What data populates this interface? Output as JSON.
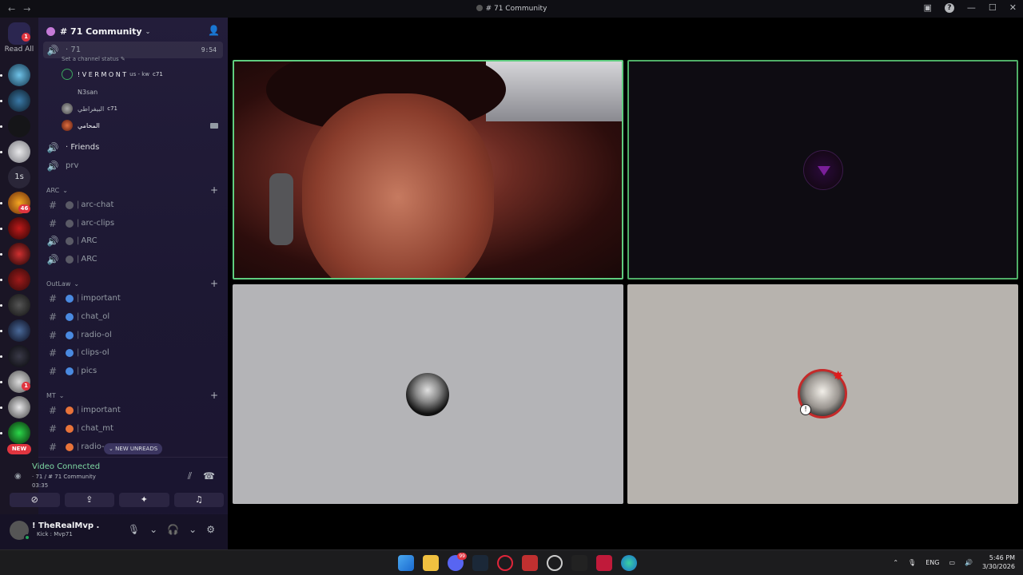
{
  "window": {
    "title": "# 71 Community",
    "nav_back": "←",
    "nav_forward": "→"
  },
  "guilds": {
    "read_all_label": "Read All",
    "home_badge": "1",
    "text_server": "1s",
    "badge_46": "46",
    "badge_1": "1",
    "new_label": "NEW"
  },
  "server": {
    "name": "# 71 Community",
    "chevron": "⌄"
  },
  "active_voice": {
    "name": "· 71",
    "time": "9:54",
    "status_hint": "Set a channel status ✎",
    "users": [
      {
        "name": "! V E R M O N T",
        "suffix": "us - kw",
        "tag": "c71"
      },
      {
        "name": "N3san",
        "suffix": "",
        "tag": ""
      },
      {
        "name": "البيفراطي",
        "suffix": "",
        "tag": "c71"
      },
      {
        "name": "المحامي",
        "suffix": "",
        "tag": ""
      }
    ]
  },
  "channels_top": [
    {
      "name": "· Friends"
    },
    {
      "name": "prv"
    }
  ],
  "categories": [
    {
      "name": "ARC",
      "channels": [
        {
          "name": "arc-chat",
          "type": "text"
        },
        {
          "name": "arc-clips",
          "type": "text"
        },
        {
          "name": "ARC",
          "type": "voice"
        },
        {
          "name": "ARC",
          "type": "voice"
        }
      ]
    },
    {
      "name": "OutLaw",
      "channels": [
        {
          "name": "important",
          "type": "text"
        },
        {
          "name": "chat_ol",
          "type": "text"
        },
        {
          "name": "radio-ol",
          "type": "text"
        },
        {
          "name": "clips-ol",
          "type": "text"
        },
        {
          "name": "pics",
          "type": "text"
        }
      ]
    },
    {
      "name": "MT",
      "channels": [
        {
          "name": "important",
          "type": "text"
        },
        {
          "name": "chat_mt",
          "type": "text"
        },
        {
          "name": "radio-",
          "type": "text"
        }
      ]
    }
  ],
  "new_unreads": "⌄ NEW UNREADS",
  "voice_panel": {
    "status": "Video Connected",
    "location": "· 71 / # 71 Community",
    "elapsed": "03:35"
  },
  "user": {
    "name": "! TheRealMvp .",
    "status": "Kick : Mvp71"
  },
  "taskbar": {
    "lang": "ENG",
    "time": "5:46 PM",
    "date": "3/30/2026",
    "discord_badge": "99"
  },
  "colors": {
    "speaking_border": "#5fcd7f",
    "accent_red": "#e0353f",
    "connected_green": "#7dd8a2",
    "sidebar_bg": "#1d1833"
  }
}
